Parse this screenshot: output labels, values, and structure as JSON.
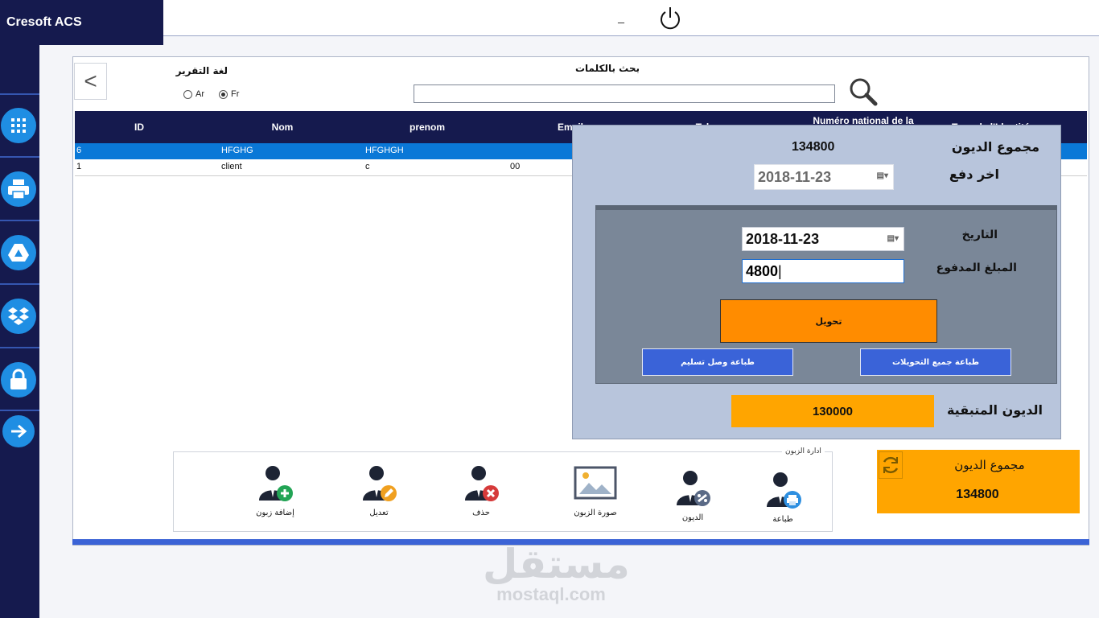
{
  "app": {
    "title": "Cresoft ACS",
    "minimize_glyph": "_"
  },
  "sidebar": {
    "items": [
      {
        "icon": "apps-grid-icon"
      },
      {
        "icon": "printer-icon"
      },
      {
        "icon": "drive-icon"
      },
      {
        "icon": "dropbox-icon"
      },
      {
        "icon": "lock-icon"
      },
      {
        "icon": "arrow-right-icon"
      }
    ]
  },
  "header": {
    "back_glyph": "<",
    "report_language_label": "لغة التقرير",
    "languages": [
      {
        "label": "Ar",
        "selected": false
      },
      {
        "label": "Fr",
        "selected": true
      }
    ],
    "search_label": "بحث بالكلمات",
    "search_value": ""
  },
  "table": {
    "columns": [
      "ID",
      "Nom",
      "prenom",
      "Email",
      "Tel",
      "Numéro national de la",
      "Type de l'Identité"
    ],
    "rows": [
      {
        "id": "6",
        "nom": "HFGHG",
        "prenom": "HFGHGH",
        "email": "",
        "selected": true
      },
      {
        "id": "1",
        "nom": "client",
        "prenom": "c",
        "email": "00",
        "selected": false
      }
    ]
  },
  "dialog": {
    "total_debts_label": "مجموع الديون",
    "total_debts_value": "134800",
    "last_payment_label": "اخر دفع",
    "last_payment_date": "2018-11-23",
    "date_label": "التاريخ",
    "date_value": "2018-11-23",
    "amount_label": "المبلغ المدفوع",
    "amount_value": "4800",
    "transfer_button": "تحويل",
    "print_receipt_button": "طباعة وصل تسليم",
    "print_all_button": "طباعة جميع التحويلات",
    "remaining_label": "الديون المتبقية",
    "remaining_value": "130000"
  },
  "totals": {
    "label": "مجموع الديون",
    "value": "134800"
  },
  "management": {
    "group_label": "ادارة الزبون",
    "tools": [
      {
        "label": "إضافة زبون",
        "icon": "add-customer-icon"
      },
      {
        "label": "تعديل",
        "icon": "edit-customer-icon"
      },
      {
        "label": "حذف",
        "icon": "delete-customer-icon"
      },
      {
        "label": "صورة الزبون",
        "icon": "customer-photo-icon"
      },
      {
        "label": "الديون",
        "icon": "customer-debts-icon"
      },
      {
        "label": "طباعة",
        "icon": "print-customer-icon"
      }
    ]
  },
  "watermark": {
    "arabic": "مستقل",
    "latin": "mostaql.com"
  },
  "colors": {
    "navy": "#151a4e",
    "accent_blue": "#1f8ee3",
    "orange": "#ff8c00",
    "amber": "#ffa500",
    "selection": "#0a78d7"
  }
}
